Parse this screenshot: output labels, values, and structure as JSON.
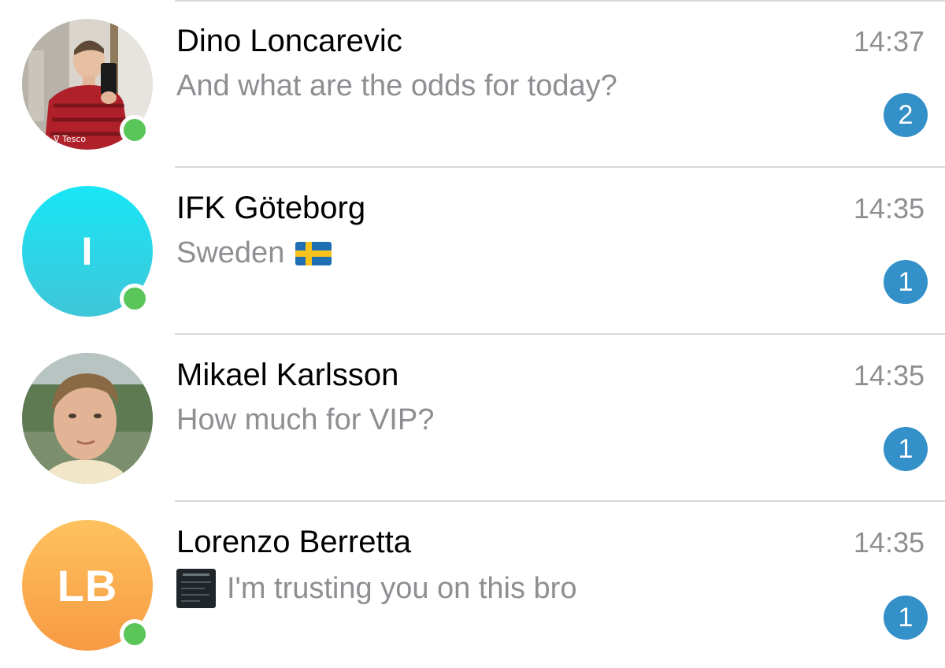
{
  "chats": [
    {
      "name": "Dino Loncarevic",
      "preview": "And what are the odds for today?",
      "time": "14:37",
      "unread": "2",
      "online": true,
      "avatar_type": "photo"
    },
    {
      "name": "IFK Göteborg",
      "preview": "Sweden",
      "preview_emoji": "flag-sweden",
      "time": "14:35",
      "unread": "1",
      "online": true,
      "avatar_type": "initials",
      "avatar_initials": "I",
      "avatar_color": "#28d3e0"
    },
    {
      "name": "Mikael Karlsson",
      "preview": "How much for VIP?",
      "time": "14:35",
      "unread": "1",
      "online": false,
      "avatar_type": "photo"
    },
    {
      "name": "Lorenzo Berretta",
      "preview": "I'm trusting you on this bro",
      "preview_attachment": "image-thumbnail",
      "time": "14:35",
      "unread": "1",
      "online": true,
      "avatar_type": "initials",
      "avatar_initials": "LB",
      "avatar_color": "#f9a94e"
    }
  ],
  "colors": {
    "badge": "#3490c8",
    "online": "#5ac65a",
    "secondary_text": "#8e8e93",
    "separator": "#d9d9d9"
  }
}
